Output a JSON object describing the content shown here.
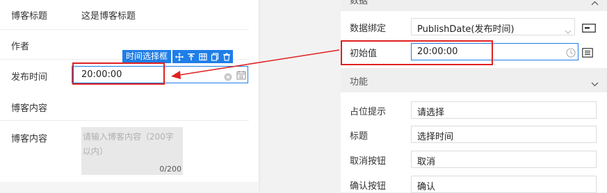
{
  "form": {
    "rows": [
      {
        "label": "博客标题",
        "value": "这是博客标题"
      },
      {
        "label": "作者",
        "value": ""
      },
      {
        "label": "发布时间",
        "value": "20:00:00"
      },
      {
        "label": "博客内容",
        "value": ""
      },
      {
        "label": "博客内容",
        "value": ""
      }
    ],
    "selected_component": "时间选择框",
    "toolbar_icons": [
      "move-icon",
      "align-top-icon",
      "table-icon",
      "copy-icon",
      "delete-icon"
    ],
    "textarea": {
      "placeholder": "请输入博客内容（200字以内）",
      "counter": "0/200"
    }
  },
  "panel": {
    "data_section_title": "数据",
    "data_binding_label": "数据绑定",
    "data_binding_value": "PublishDate(发布时间)",
    "initial_value_label": "初始值",
    "initial_value": "20:00:00",
    "feature_section_title": "功能",
    "fields": [
      {
        "label": "占位提示",
        "value": "请选择"
      },
      {
        "label": "标题",
        "value": "选择时间"
      },
      {
        "label": "取消按钮",
        "value": "取消"
      },
      {
        "label": "确认按钮",
        "value": "确认"
      }
    ]
  },
  "colors": {
    "accent": "#1f7ee8",
    "highlight": "#e02020"
  }
}
